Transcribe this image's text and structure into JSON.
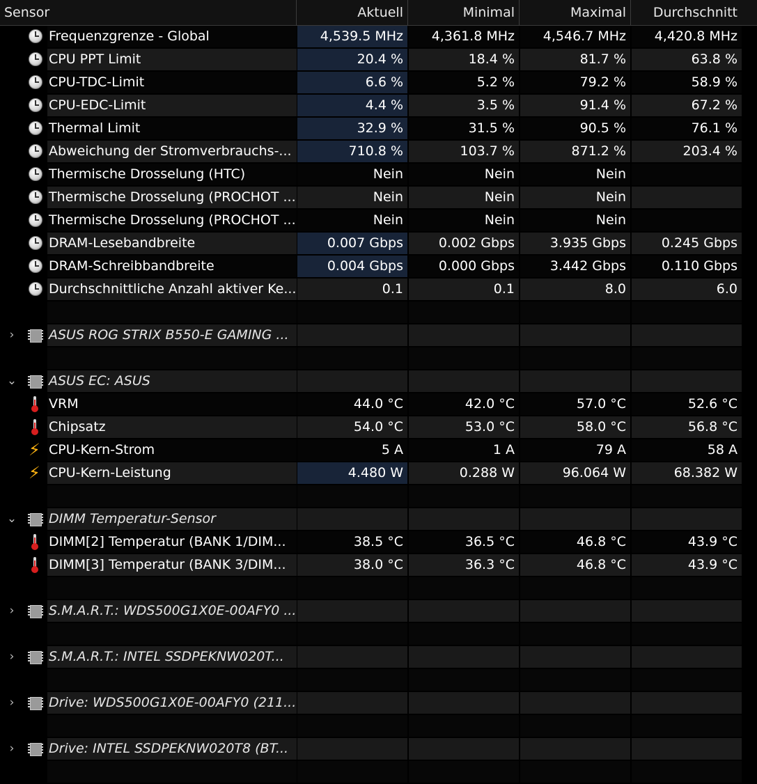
{
  "header": {
    "sensor": "Sensor",
    "current": "Aktuell",
    "min": "Minimal",
    "max": "Maximal",
    "avg": "Durchschnitt"
  },
  "rows": [
    {
      "kind": "sensor",
      "icon": "clock",
      "shade": false,
      "hl": true,
      "label": "Frequenzgrenze - Global",
      "cur": "4,539.5 MHz",
      "min": "4,361.8 MHz",
      "max": "4,546.7 MHz",
      "avg": "4,420.8 MHz"
    },
    {
      "kind": "sensor",
      "icon": "clock",
      "shade": true,
      "hl": true,
      "label": "CPU PPT Limit",
      "cur": "20.4 %",
      "min": "18.4 %",
      "max": "81.7 %",
      "avg": "63.8 %"
    },
    {
      "kind": "sensor",
      "icon": "clock",
      "shade": false,
      "hl": true,
      "label": "CPU-TDC-Limit",
      "cur": "6.6 %",
      "min": "5.2 %",
      "max": "79.2 %",
      "avg": "58.9 %"
    },
    {
      "kind": "sensor",
      "icon": "clock",
      "shade": true,
      "hl": true,
      "label": "CPU-EDC-Limit",
      "cur": "4.4 %",
      "min": "3.5 %",
      "max": "91.4 %",
      "avg": "67.2 %"
    },
    {
      "kind": "sensor",
      "icon": "clock",
      "shade": false,
      "hl": true,
      "label": "Thermal Limit",
      "cur": "32.9 %",
      "min": "31.5 %",
      "max": "90.5 %",
      "avg": "76.1 %"
    },
    {
      "kind": "sensor",
      "icon": "clock",
      "shade": true,
      "hl": true,
      "label": "Abweichung der Stromverbrauchs-...",
      "cur": "710.8 %",
      "min": "103.7 %",
      "max": "871.2 %",
      "avg": "203.4 %"
    },
    {
      "kind": "sensor",
      "icon": "clock",
      "shade": false,
      "hl": false,
      "label": "Thermische Drosselung (HTC)",
      "cur": "Nein",
      "min": "Nein",
      "max": "Nein",
      "avg": ""
    },
    {
      "kind": "sensor",
      "icon": "clock",
      "shade": true,
      "hl": false,
      "label": "Thermische Drosselung (PROCHOT ...",
      "cur": "Nein",
      "min": "Nein",
      "max": "Nein",
      "avg": ""
    },
    {
      "kind": "sensor",
      "icon": "clock",
      "shade": false,
      "hl": false,
      "label": "Thermische Drosselung (PROCHOT ...",
      "cur": "Nein",
      "min": "Nein",
      "max": "Nein",
      "avg": ""
    },
    {
      "kind": "sensor",
      "icon": "clock",
      "shade": true,
      "hl": true,
      "label": "DRAM-Lesebandbreite",
      "cur": "0.007 Gbps",
      "min": "0.002 Gbps",
      "max": "3.935 Gbps",
      "avg": "0.245 Gbps"
    },
    {
      "kind": "sensor",
      "icon": "clock",
      "shade": false,
      "hl": true,
      "label": "DRAM-Schreibbandbreite",
      "cur": "0.004 Gbps",
      "min": "0.000 Gbps",
      "max": "3.442 Gbps",
      "avg": "0.110 Gbps"
    },
    {
      "kind": "sensor",
      "icon": "clock",
      "shade": true,
      "hl": false,
      "label": "Durchschnittliche Anzahl aktiver Ke...",
      "cur": "0.1",
      "min": "0.1",
      "max": "8.0",
      "avg": "6.0"
    },
    {
      "kind": "spacer"
    },
    {
      "kind": "group",
      "expanded": false,
      "label": "ASUS ROG STRIX B550-E GAMING ..."
    },
    {
      "kind": "spacer"
    },
    {
      "kind": "group",
      "expanded": true,
      "label": "ASUS EC: ASUS"
    },
    {
      "kind": "sensor",
      "icon": "therm",
      "shade": false,
      "hl": false,
      "label": "VRM",
      "cur": "44.0 °C",
      "min": "42.0 °C",
      "max": "57.0 °C",
      "avg": "52.6 °C"
    },
    {
      "kind": "sensor",
      "icon": "therm",
      "shade": true,
      "hl": false,
      "label": "Chipsatz",
      "cur": "54.0 °C",
      "min": "53.0 °C",
      "max": "58.0 °C",
      "avg": "56.8 °C"
    },
    {
      "kind": "sensor",
      "icon": "bolt",
      "shade": false,
      "hl": false,
      "label": "CPU-Kern-Strom",
      "cur": "5 A",
      "min": "1 A",
      "max": "79 A",
      "avg": "58 A"
    },
    {
      "kind": "sensor",
      "icon": "bolt",
      "shade": true,
      "hl": true,
      "label": "CPU-Kern-Leistung",
      "cur": "4.480 W",
      "min": "0.288 W",
      "max": "96.064 W",
      "avg": "68.382 W"
    },
    {
      "kind": "spacer"
    },
    {
      "kind": "group",
      "expanded": true,
      "label": "DIMM Temperatur-Sensor"
    },
    {
      "kind": "sensor",
      "icon": "therm",
      "shade": false,
      "hl": false,
      "label": "DIMM[2] Temperatur (BANK 1/DIM...",
      "cur": "38.5 °C",
      "min": "36.5 °C",
      "max": "46.8 °C",
      "avg": "43.9 °C"
    },
    {
      "kind": "sensor",
      "icon": "therm",
      "shade": true,
      "hl": false,
      "label": "DIMM[3] Temperatur (BANK 3/DIM...",
      "cur": "38.0 °C",
      "min": "36.3 °C",
      "max": "46.8 °C",
      "avg": "43.9 °C"
    },
    {
      "kind": "spacer"
    },
    {
      "kind": "group",
      "expanded": false,
      "label": "S.M.A.R.T.: WDS500G1X0E-00AFY0 ..."
    },
    {
      "kind": "spacer"
    },
    {
      "kind": "group",
      "expanded": false,
      "label": "S.M.A.R.T.: INTEL SSDPEKNW020T..."
    },
    {
      "kind": "spacer"
    },
    {
      "kind": "group",
      "expanded": false,
      "label": "Drive: WDS500G1X0E-00AFY0 (211..."
    },
    {
      "kind": "spacer"
    },
    {
      "kind": "group",
      "expanded": false,
      "label": "Drive: INTEL SSDPEKNW020T8 (BT..."
    },
    {
      "kind": "spacer"
    }
  ]
}
